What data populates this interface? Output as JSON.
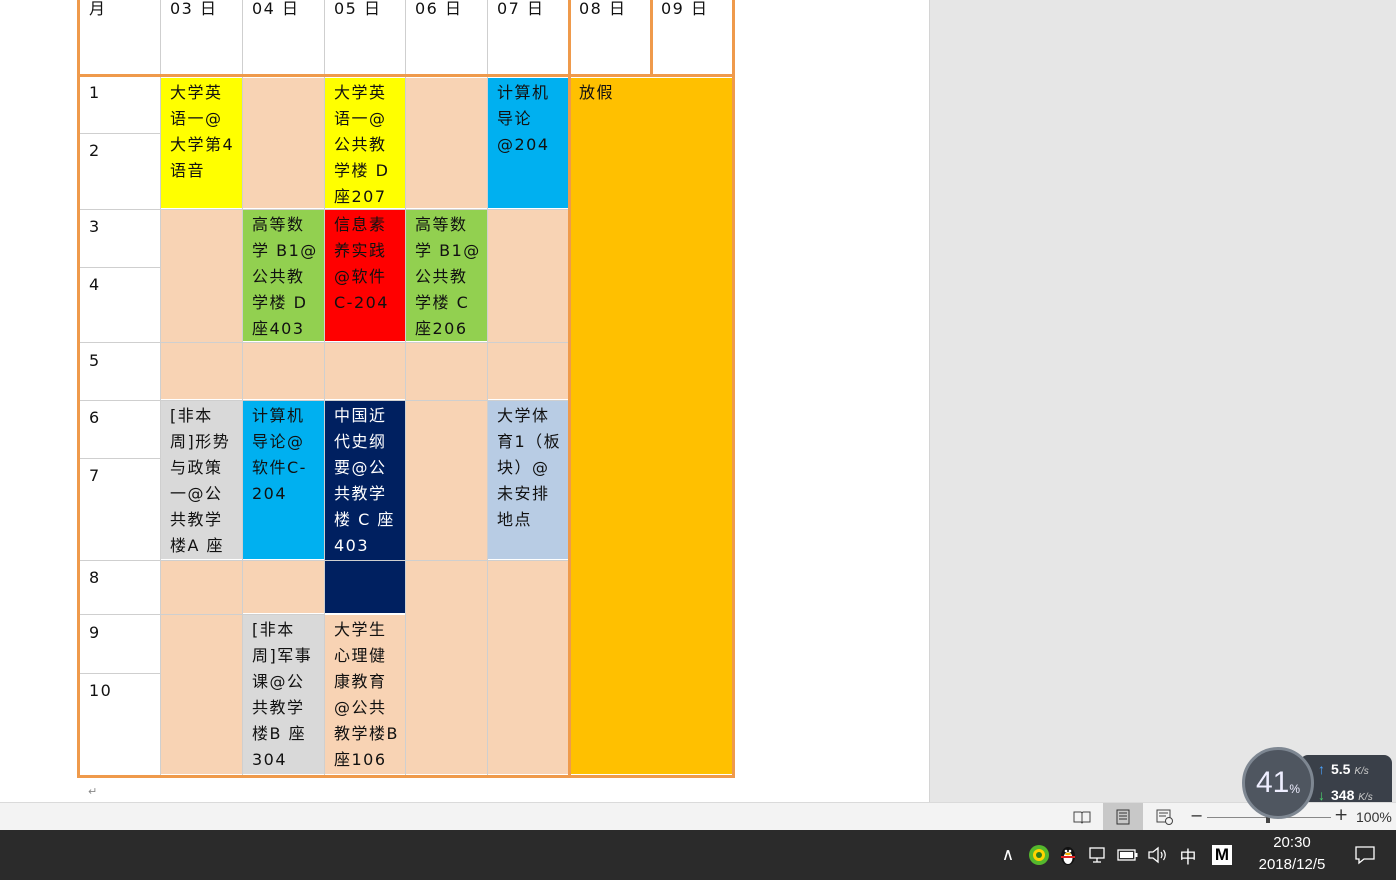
{
  "header_row": [
    "月",
    "03 日",
    "04 日",
    "05 日",
    "06 日",
    "07 日",
    "08 日",
    "09 日"
  ],
  "row_labels": [
    "1",
    "2",
    "3",
    "4",
    "5",
    "6",
    "7",
    "8",
    "9",
    "10"
  ],
  "paragraph_mark": "↵",
  "cells": [
    {
      "text": "大学英语一@大学第4语音",
      "color": "#ffff00"
    },
    {
      "text": "",
      "color": "#f8d3b4"
    },
    {
      "text": "大学英语一@公共教学楼 D 座207",
      "color": "#ffff00"
    },
    {
      "text": "",
      "color": "#f8d3b4"
    },
    {
      "text": "计算机导论@204",
      "color": "#00b0f0"
    },
    {
      "text": "放假",
      "color": "#ffc000"
    },
    {
      "text": "",
      "color": "#f8d3b4"
    },
    {
      "text": "高等数学 B1@公共教学楼 D 座403",
      "color": "#92d050"
    },
    {
      "text": "信息素养实践@软件C-204",
      "color": "#ff0000"
    },
    {
      "text": "高等数学 B1@公共教学楼 C 座206",
      "color": "#92d050"
    },
    {
      "text": "",
      "color": "#f8d3b4"
    },
    {
      "text": "",
      "color": "#f8d3b4"
    },
    {
      "text": "",
      "color": "#f8d3b4"
    },
    {
      "text": "",
      "color": "#f8d3b4"
    },
    {
      "text": "[非本周]形势与政策一@公共教学楼A 座406",
      "color": "#d9d9d9"
    },
    {
      "text": "计算机导论@软件C-204",
      "color": "#00b0f0"
    },
    {
      "text": "中国近代史纲要@公共教学楼 C 座403",
      "color": "#002060"
    },
    {
      "text": "大学体育1（板块）@未安排地点",
      "color": "#b8cce4"
    },
    {
      "text": "",
      "color": "#f8d3b4"
    },
    {
      "text": "",
      "color": "#f8d3b4"
    },
    {
      "text": "",
      "color": "#f8d3b4"
    },
    {
      "text": "[非本周]军事课@公共教学楼B 座304",
      "color": "#d9d9d9"
    },
    {
      "text": "大学生心理健康教育@公共教学楼B 座106",
      "color": "#f8d3b4"
    }
  ],
  "statusbar": {
    "view_read_icon": "book-icon",
    "view_print_icon": "page-layout-icon",
    "view_web_icon": "web-layout-icon",
    "zoom_minus": "−",
    "zoom_plus": "+",
    "zoom_level": "100%"
  },
  "taskbar": {
    "chevron": "∧",
    "ime": "中",
    "m_icon": "M",
    "time": "20:30",
    "date": "2018/12/5"
  },
  "net_widget": {
    "percent": "41",
    "percent_unit": "%",
    "up_speed": "5.5",
    "down_speed": "348",
    "unit": "K/s"
  }
}
